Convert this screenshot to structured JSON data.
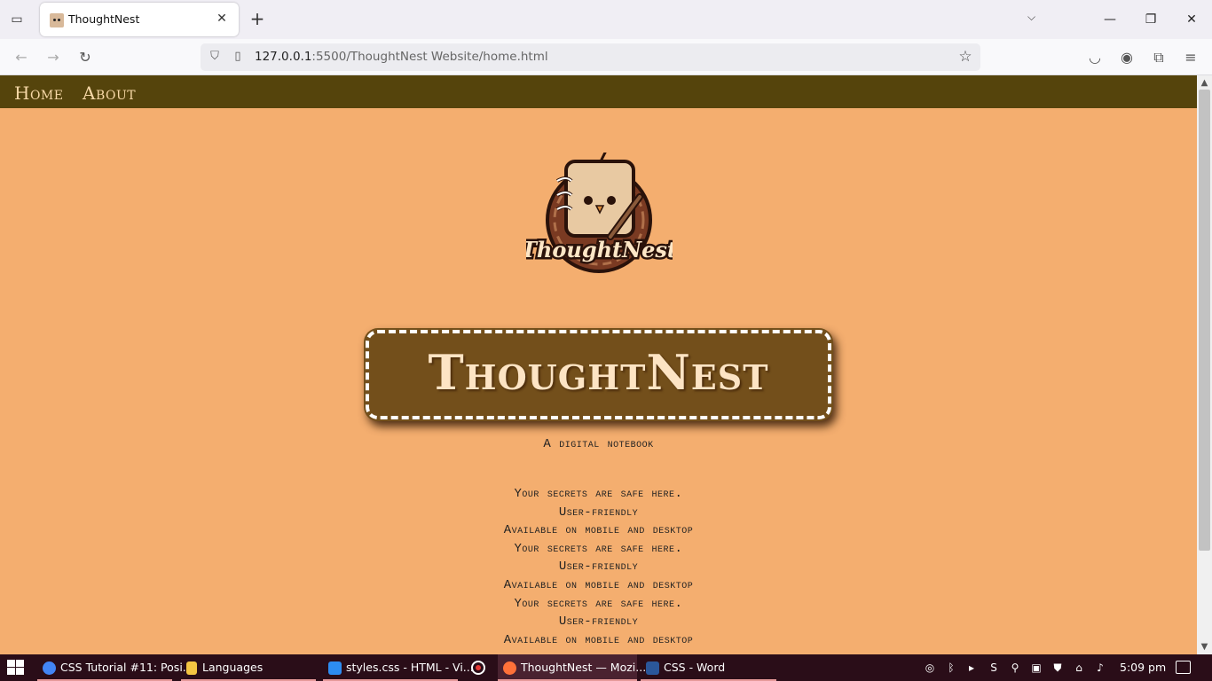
{
  "browser": {
    "tab": {
      "title": "ThoughtNest"
    },
    "url": {
      "host": "127.0.0.1",
      "rest": ":5500/ThoughtNest Website/home.html"
    }
  },
  "site": {
    "nav": [
      {
        "label": "Home"
      },
      {
        "label": "About"
      }
    ],
    "logo_text": "ThoughtNest",
    "title": "ThoughtNest",
    "tagline": "A digital notebook",
    "features": [
      "Your secrets are safe here.",
      "User-friendly",
      "Available on mobile and desktop",
      "Your secrets are safe here.",
      "User-friendly",
      "Available on mobile and desktop",
      "Your secrets are safe here.",
      "User-friendly",
      "Available on mobile and desktop"
    ]
  },
  "taskbar": {
    "items": [
      {
        "label": "CSS Tutorial #11: Posi...",
        "icon": "chrome-icon",
        "color": "#4285f4"
      },
      {
        "label": "Languages",
        "icon": "folder-icon",
        "color": "#f4c542"
      },
      {
        "label": "styles.css - HTML - Vi...",
        "icon": "vscode-icon",
        "color": "#2d8cf0"
      },
      {
        "label": "ThoughtNest — Mozi...",
        "icon": "firefox-icon",
        "color": "#ff7139"
      },
      {
        "label": "CSS - Word",
        "icon": "word-icon",
        "color": "#2b579a"
      }
    ],
    "clock": "5:09 pm"
  },
  "colors": {
    "page_bg": "#f4ae6f",
    "nav_bg": "#55440c",
    "title_box": "#734f1b",
    "taskbar_bg": "#2a0d18"
  }
}
